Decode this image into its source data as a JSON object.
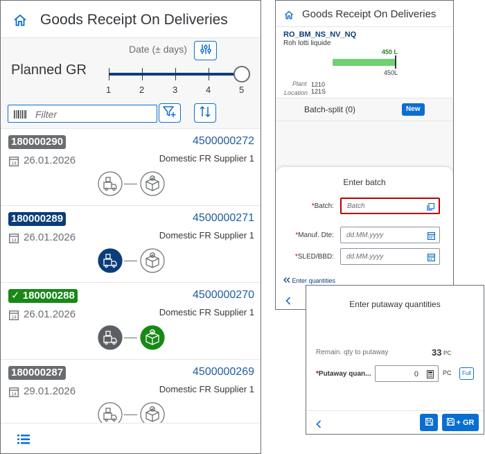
{
  "left": {
    "title": "Goods Receipt On Deliveries",
    "date_filter_label": "Date (± days)",
    "planned_label": "Planned GR",
    "slider": {
      "ticks": [
        "1",
        "2",
        "3",
        "4",
        "5"
      ],
      "value": 5
    },
    "filter_placeholder": "Filter",
    "items": [
      {
        "delivery": "180000290",
        "po": "4500000272",
        "date": "26.01.2026",
        "supplier": "Domestic FR Supplier 1",
        "badge_color": "#6a6d70",
        "checked": false,
        "step1": "outline",
        "step2": "outline"
      },
      {
        "delivery": "180000289",
        "po": "4500000271",
        "date": "26.01.2026",
        "supplier": "Domestic FR Supplier 1",
        "badge_color": "#0a3d7a",
        "checked": false,
        "step1": "blue",
        "step2": "outline"
      },
      {
        "delivery": "✓ 180000288",
        "po": "4500000270",
        "date": "26.01.2026",
        "supplier": "Domestic FR Supplier 1",
        "badge_color": "#188918",
        "checked": true,
        "step1": "gray",
        "step2": "green"
      },
      {
        "delivery": "180000287",
        "po": "4500000269",
        "date": "29.01.2026",
        "supplier": "Domestic FR Supplier 1",
        "badge_color": "#6a6d70",
        "checked": false,
        "step1": "outline",
        "step2": "outline"
      }
    ]
  },
  "right_top": {
    "title": "Goods Receipt On Deliveries",
    "material": "RO_BM_NS_NV_NQ",
    "material_desc": "Roh lotti liquide",
    "qty_done": "450 L",
    "qty_total": "450L",
    "plant_label": "Plant",
    "plant_value": "1210",
    "location_label": "Location",
    "location_value": "121S",
    "batch_split_label": "Batch-split (0)",
    "new_label": "New",
    "dialog": {
      "title": "Enter batch",
      "batch_label": "Batch:",
      "batch_placeholder": "Batch",
      "manuf_label": "Manuf. Dte:",
      "manuf_placeholder": "dd.MM.yyyy",
      "sled_label": "SLED/BBD:",
      "sled_placeholder": "dd.MM.yyyy",
      "enter_quantities": "Enter quantities"
    }
  },
  "right_bottom": {
    "title": "Enter putaway quantities",
    "remain_label": "Remain. qty to putaway",
    "remain_value": "33",
    "remain_unit": "PC",
    "putaway_label": "Putaway quan...",
    "putaway_value": "0",
    "putaway_unit": "PC",
    "full_label": "Full",
    "save_gr_label": "+ GR"
  },
  "colors": {
    "accent": "#0a6ed1",
    "dark_blue": "#0a3d7a",
    "success": "#188918",
    "error": "#bb0000"
  }
}
